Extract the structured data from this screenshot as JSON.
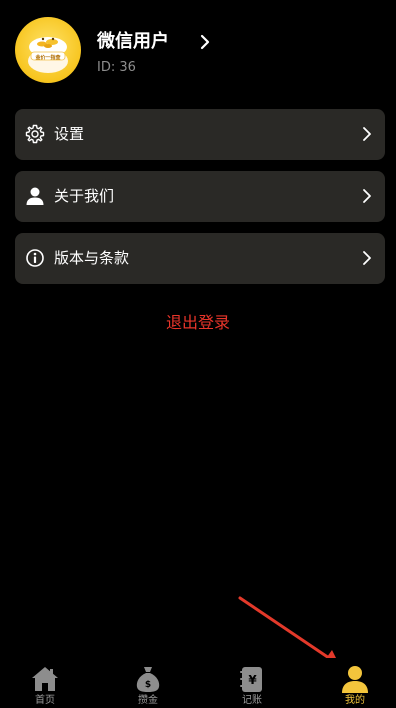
{
  "profile": {
    "name": "微信用户",
    "id_text": "ID: 36",
    "avatar_text": "金价一指查"
  },
  "menu": {
    "items": [
      {
        "label": "设置",
        "icon": "gear-icon"
      },
      {
        "label": "关于我们",
        "icon": "user-icon"
      },
      {
        "label": "版本与条款",
        "icon": "info-icon"
      }
    ]
  },
  "logout_label": "退出登录",
  "tabbar": {
    "tabs": [
      {
        "label": "首页",
        "icon": "home-icon",
        "active": false
      },
      {
        "label": "攒金",
        "icon": "money-bag-icon",
        "active": false
      },
      {
        "label": "记账",
        "icon": "ledger-icon",
        "active": false
      },
      {
        "label": "我的",
        "icon": "profile-icon",
        "active": true
      }
    ]
  },
  "colors": {
    "background": "#000000",
    "card": "#2a2926",
    "logout": "#e8352a",
    "active_tab": "#f3c53c",
    "inactive_tab": "#9a9a9a",
    "annotation_arrow": "#e3392a"
  }
}
